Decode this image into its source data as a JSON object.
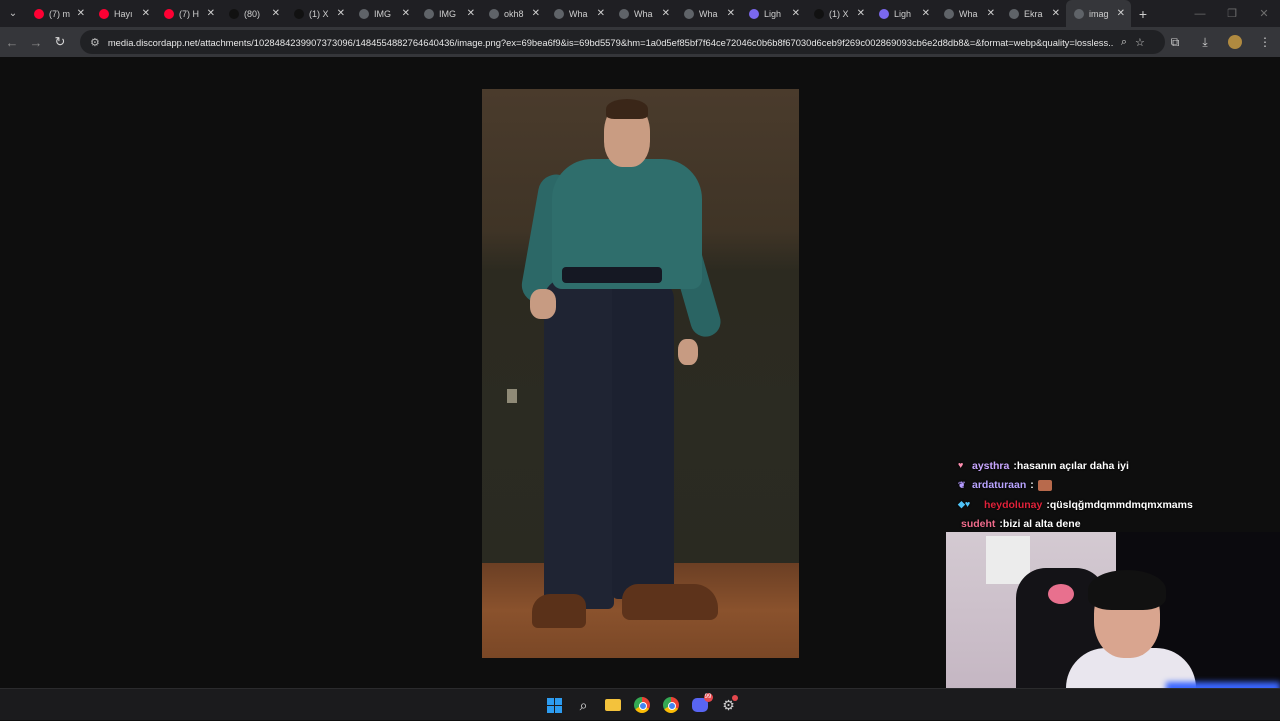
{
  "browser": {
    "tabs": [
      {
        "title": "(7) m",
        "favicon": "youtube-icon",
        "color": "#ff0033"
      },
      {
        "title": "Hayı",
        "favicon": "youtube-icon",
        "color": "#ff0033"
      },
      {
        "title": "(7) H",
        "favicon": "youtube-icon",
        "color": "#ff0033"
      },
      {
        "title": "(80)",
        "favicon": "tiktok-icon",
        "color": "#111111"
      },
      {
        "title": "(1) X",
        "favicon": "x-icon",
        "color": "#111111"
      },
      {
        "title": "IMG",
        "favicon": "globe-icon",
        "color": "#5f6368"
      },
      {
        "title": "IMG",
        "favicon": "globe-icon",
        "color": "#5f6368"
      },
      {
        "title": "okh8",
        "favicon": "globe-icon",
        "color": "#5f6368"
      },
      {
        "title": "Wha",
        "favicon": "globe-icon",
        "color": "#5f6368"
      },
      {
        "title": "Wha",
        "favicon": "globe-icon",
        "color": "#5f6368"
      },
      {
        "title": "Wha",
        "favicon": "globe-icon",
        "color": "#5f6368"
      },
      {
        "title": "Ligh",
        "favicon": "feather-icon",
        "color": "#7b68ee"
      },
      {
        "title": "(1) X",
        "favicon": "x-icon",
        "color": "#111111"
      },
      {
        "title": "Ligh",
        "favicon": "feather-icon",
        "color": "#7b68ee"
      },
      {
        "title": "Wha",
        "favicon": "globe-icon",
        "color": "#5f6368"
      },
      {
        "title": "Ekra",
        "favicon": "globe-icon",
        "color": "#5f6368"
      },
      {
        "title": "imag",
        "favicon": "globe-icon",
        "color": "#5f6368",
        "active": true
      }
    ],
    "new_tab_label": "+",
    "url": "media.discordapp.net/attachments/1028484239907373096/1484554882764640436/image.png?ex=69bea6f9&is=69bd5579&hm=1a0d5ef85bf7f64ce72046c0b6b8f67030d6ceb9f269c002869093cb6e2d8db8&=&format=webp&quality=lossless..."
  },
  "chat": {
    "messages": [
      {
        "user": "aysthra",
        "user_color": "#c9a7ff",
        "badge": "heart",
        "text": "hasanın açılar daha iyi"
      },
      {
        "user": "ardaturaan",
        "user_color": "#b9a4ff",
        "badge": "butterfly",
        "text": "",
        "emote": true
      },
      {
        "user": "heydolunay",
        "user_color": "#e0223a",
        "badge": "cube-heart",
        "text": "qüslqğmdqmmdmqmxmams"
      },
      {
        "user": "sudeht",
        "user_color": "#f06c8c",
        "badge": "",
        "text": "bizi al alta dene"
      }
    ]
  },
  "taskbar": {
    "discord_badge": "99"
  },
  "colors": {
    "tabbar_bg": "#1f1f23",
    "toolbar_bg": "#35363a",
    "page_bg": "#0e0e0e"
  }
}
